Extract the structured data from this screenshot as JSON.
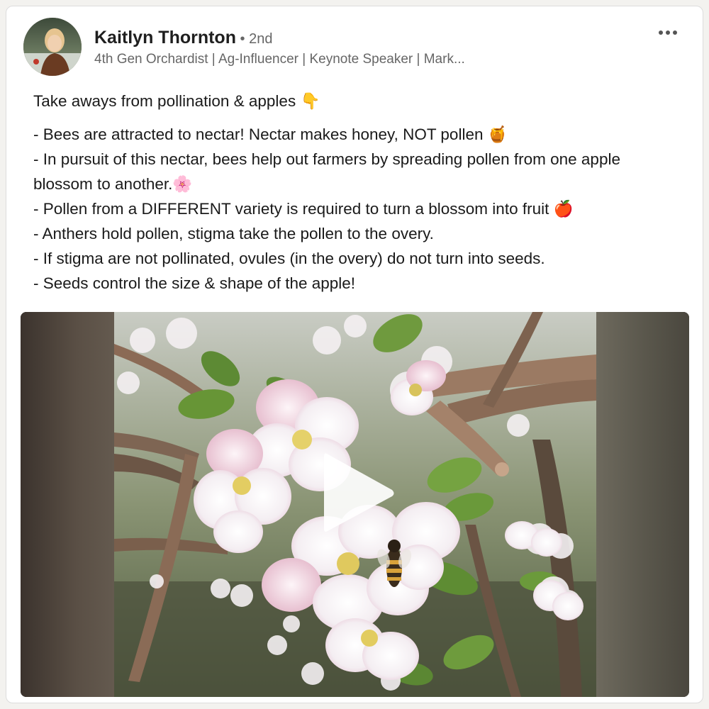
{
  "author": {
    "name": "Kaitlyn Thornton",
    "degree": " • 2nd",
    "headline": "4th Gen Orchardist | Ag-Influencer | Keynote Speaker | Mark..."
  },
  "post": {
    "intro": "Take aways from pollination & apples  👇",
    "lines": [
      "- Bees are attracted to nectar! Nectar makes honey, NOT pollen 🍯",
      "- In pursuit of this nectar, bees help out farmers by spreading pollen from one apple blossom to another.🌸",
      "- Pollen from a DIFFERENT variety is required to turn a blossom into fruit 🍎",
      "- Anthers hold pollen, stigma take the pollen to the overy.",
      "- If stigma are not pollinated, ovules (in the overy) do not turn into seeds.",
      "- Seeds control the size & shape of the apple!"
    ]
  },
  "icons": {
    "more": "more-options-icon",
    "play": "play-icon"
  },
  "colors": {
    "name": "#1f1f1f",
    "secondary_text": "#666666",
    "card_background": "#ffffff",
    "page_background": "#f3f2ef"
  }
}
